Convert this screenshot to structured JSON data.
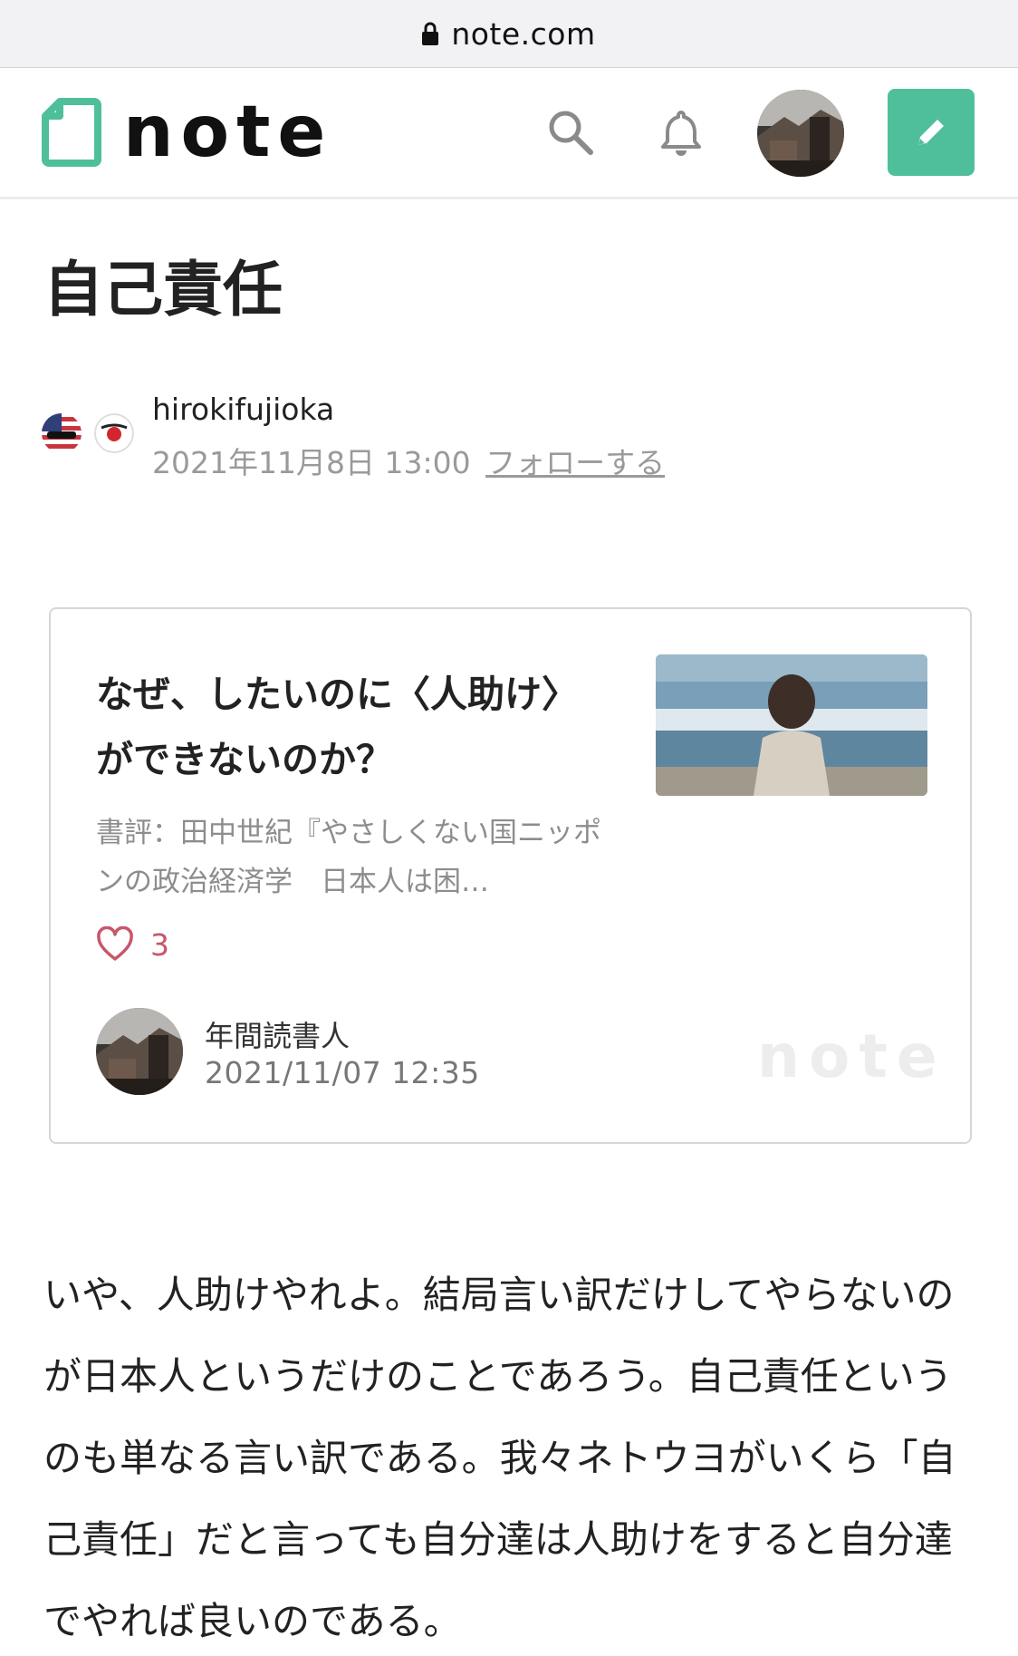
{
  "browser": {
    "url": "note.com",
    "lock_icon": "lock-icon"
  },
  "header": {
    "logo_text": "note",
    "icons": [
      "note-logo-icon",
      "search-icon",
      "bell-icon",
      "avatar",
      "pencil-icon"
    ],
    "accent_color": "#4fbf9b"
  },
  "article": {
    "title": "自己責任",
    "author": {
      "name": "hirokifujioka",
      "flag_icons": [
        "us-flag-icon",
        "japan-flag-icon"
      ]
    },
    "datetime": "2021年11月8日 13:00",
    "follow_label": "フォローする",
    "body": "いや、人助けやれよ。結局言い訳だけしてやらないのが日本人というだけのことであろう。自己責任というのも単なる言い訳である。我々ネトウヨがいくら「自己責任」だと言っても自分達は人助けをすると自分達でやれば良いのである。"
  },
  "embed": {
    "title": "なぜ、したいのに〈人助け〉ができないのか？",
    "excerpt": "書評：田中世紀『やさしくない国ニッポンの政治経済学　日本人は困…",
    "likes": "3",
    "author": "年間読書人",
    "date": "2021/11/07 12:35",
    "brand": "note",
    "like_color": "#c8566b"
  }
}
